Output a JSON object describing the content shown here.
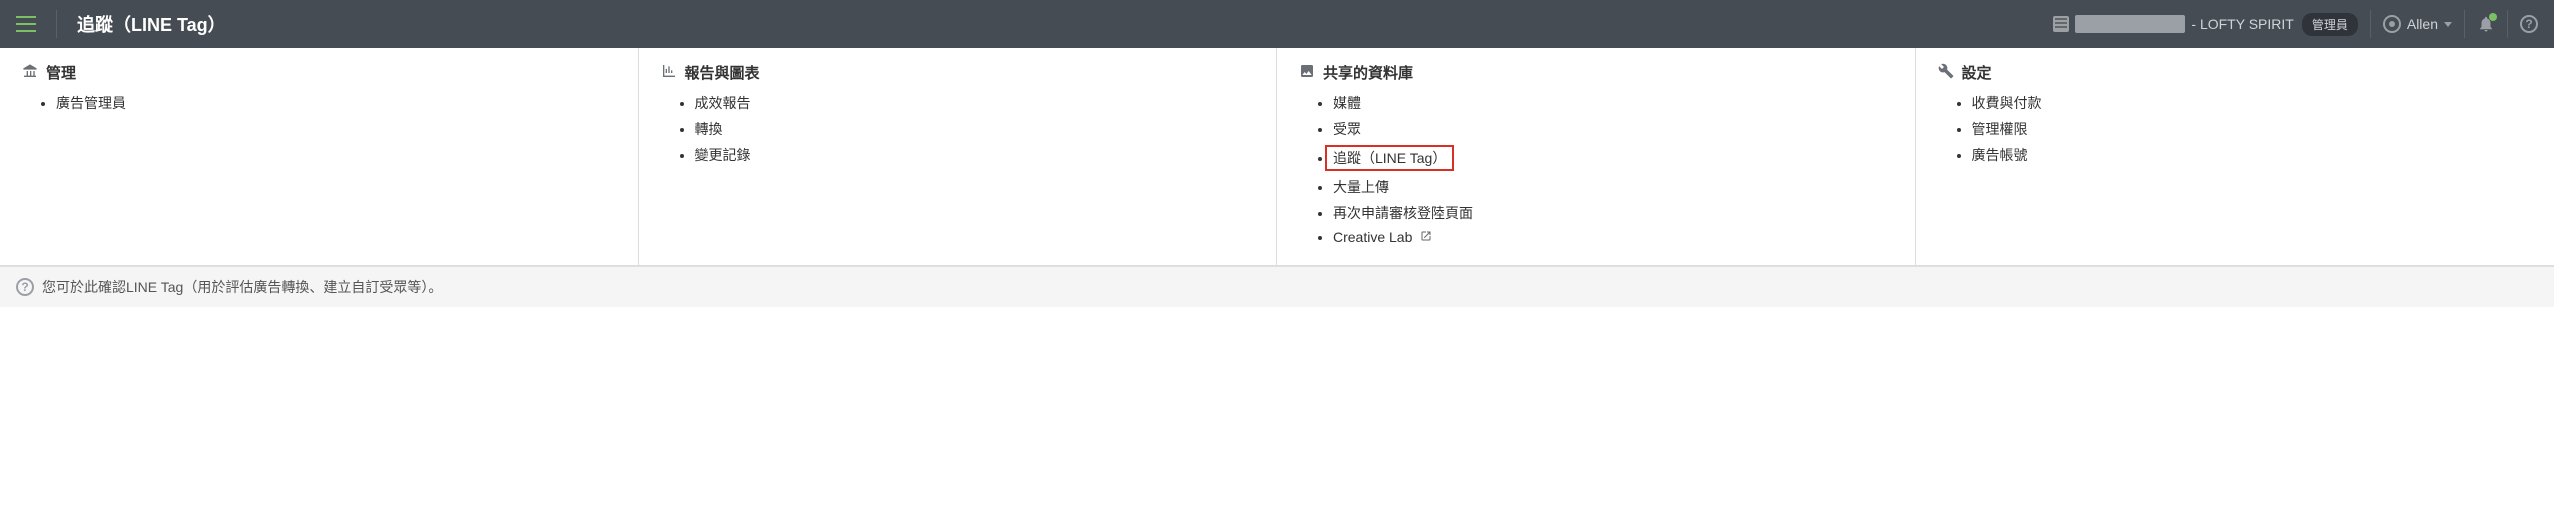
{
  "header": {
    "page_title": "追蹤（LINE Tag）",
    "org_suffix": " - LOFTY SPIRIT",
    "role_label": "管理員",
    "user_name": "Allen"
  },
  "menu": {
    "col1": {
      "heading": "管理",
      "items": [
        "廣告管理員"
      ]
    },
    "col2": {
      "heading": "報告與圖表",
      "items": [
        "成效報告",
        "轉換",
        "變更記錄"
      ]
    },
    "col3": {
      "heading": "共享的資料庫",
      "items": [
        "媒體",
        "受眾",
        "追蹤（LINE Tag）",
        "大量上傳",
        "再次申請審核登陸頁面",
        "Creative Lab"
      ]
    },
    "col4": {
      "heading": "設定",
      "items": [
        "收費與付款",
        "管理權限",
        "廣告帳號"
      ]
    }
  },
  "info_bar": {
    "text": "您可於此確認LINE Tag（用於評估廣告轉換、建立自訂受眾等）。"
  }
}
